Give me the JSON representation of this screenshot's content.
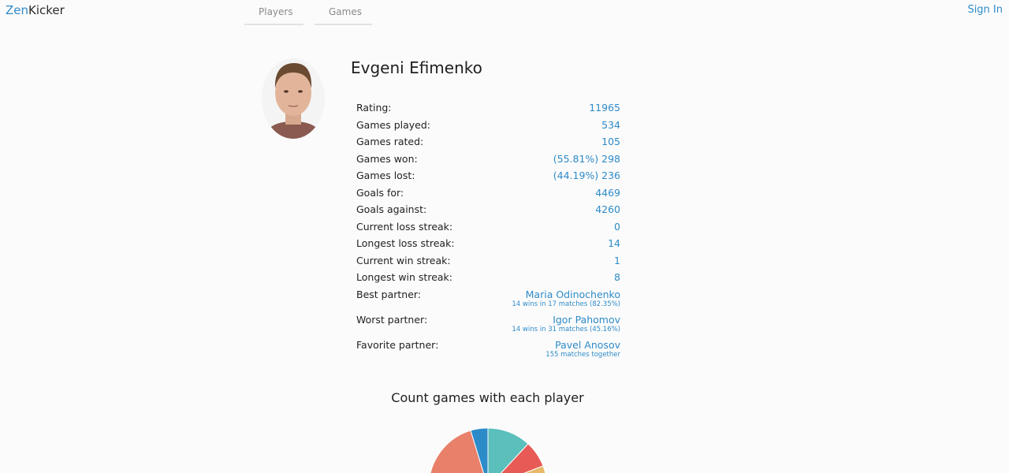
{
  "header": {
    "logo_zen": "Zen",
    "logo_kicker": "Kicker",
    "tabs": [
      {
        "label": "Players"
      },
      {
        "label": "Games"
      }
    ],
    "signin_label": "Sign In"
  },
  "player": {
    "name": "Evgeni Efimenko",
    "avatar_icon": "player-photo"
  },
  "stats": [
    {
      "label": "Rating:",
      "value": "11965"
    },
    {
      "label": "Games played:",
      "value": "534"
    },
    {
      "label": "Games rated:",
      "value": "105"
    },
    {
      "label": "Games won:",
      "value": "(55.81%) 298"
    },
    {
      "label": "Games lost:",
      "value": "(44.19%) 236"
    },
    {
      "label": "Goals for:",
      "value": "4469"
    },
    {
      "label": "Goals against:",
      "value": "4260"
    },
    {
      "label": "Current loss streak:",
      "value": "0"
    },
    {
      "label": "Longest loss streak:",
      "value": "14"
    },
    {
      "label": "Current win streak:",
      "value": "1"
    },
    {
      "label": "Longest win streak:",
      "value": "8"
    }
  ],
  "partners": [
    {
      "label": "Best partner:",
      "name": "Maria Odinochenko",
      "detail": "14 wins in 17 matches (82.35%)"
    },
    {
      "label": "Worst partner:",
      "name": "Igor Pahomov",
      "detail": "14 wins in 31 matches (45.16%)"
    },
    {
      "label": "Favorite partner:",
      "name": "Pavel Anosov",
      "detail": "155 matches together"
    }
  ],
  "chart_title": "Count games with each player",
  "colors": {
    "accent": "#2e8bc9",
    "pie_teal": "#5bbfbc",
    "pie_red": "#e85a55",
    "pie_yellow": "#e7b86a",
    "pie_salmon": "#e8806a",
    "pie_blue": "#2e8bc9"
  }
}
